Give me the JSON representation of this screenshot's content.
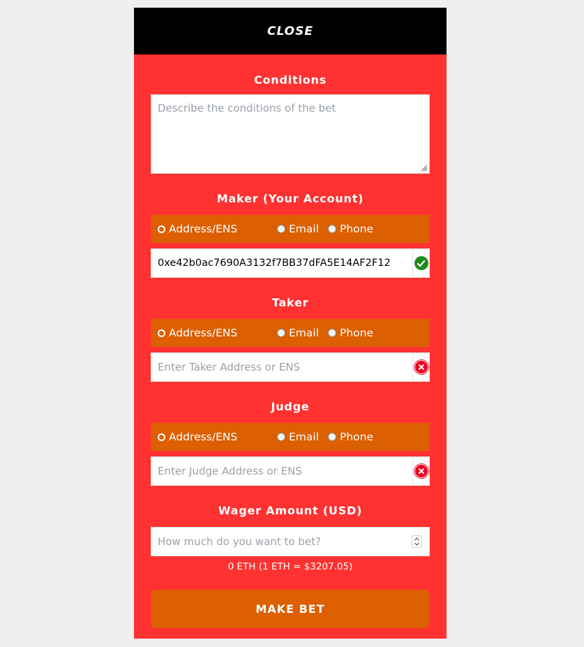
{
  "header": {
    "close_label": "CLOSE"
  },
  "conditions": {
    "title": "Conditions",
    "placeholder": "Describe the conditions of the bet"
  },
  "maker": {
    "title": "Maker (Your Account)",
    "options": [
      "Address/ENS",
      "Email",
      "Phone"
    ],
    "selected": "Address/ENS",
    "value": "0xe42b0ac7690A3132f7BB37dFA5E14AF2F12",
    "status": "valid"
  },
  "taker": {
    "title": "Taker",
    "options": [
      "Address/ENS",
      "Email",
      "Phone"
    ],
    "selected": "Address/ENS",
    "placeholder": "Enter Taker Address or ENS",
    "status": "invalid"
  },
  "judge": {
    "title": "Judge",
    "options": [
      "Address/ENS",
      "Email",
      "Phone"
    ],
    "selected": "Address/ENS",
    "placeholder": "Enter Judge Address or ENS",
    "status": "invalid"
  },
  "wager": {
    "title": "Wager Amount (USD)",
    "placeholder": "How much do you want to bet?",
    "conversion": "0 ETH (1 ETH = $3207.05)"
  },
  "submit_label": "MAKE BET",
  "colors": {
    "panel": "#ff3131",
    "accent": "#dc5f00",
    "header": "#000000",
    "valid": "#1d8a1d",
    "invalid": "#e8001c"
  }
}
